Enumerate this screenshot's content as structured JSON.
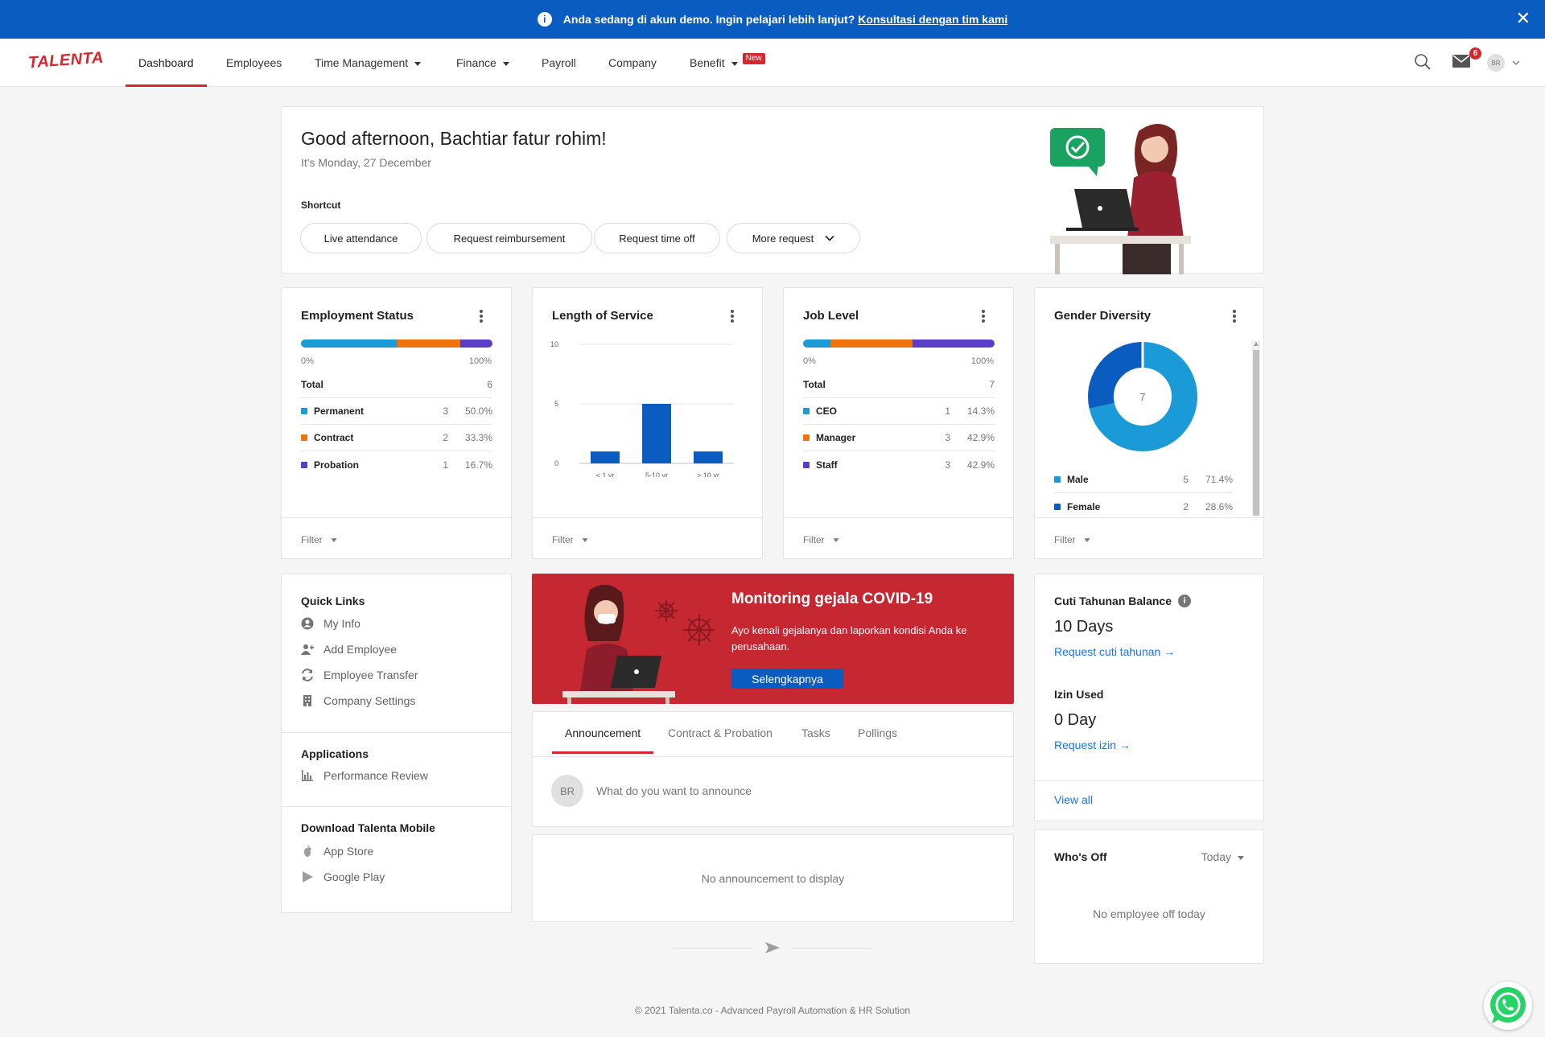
{
  "banner": {
    "text": "Anda sedang di akun demo. Ingin pelajari lebih lanjut?",
    "link": "Konsultasi dengan tim kami",
    "color": "#0b5cc0"
  },
  "nav": {
    "logo": "TALENTA",
    "items": [
      {
        "label": "Dashboard"
      },
      {
        "label": "Employees"
      },
      {
        "label": "Time Management"
      },
      {
        "label": "Finance"
      },
      {
        "label": "Payroll"
      },
      {
        "label": "Company"
      },
      {
        "label": "Benefit"
      }
    ],
    "new_badge": "New",
    "mail_count": "6",
    "avatar": "BR",
    "accent": "#d7262d"
  },
  "greeting": {
    "title": "Good afternoon, Bachtiar fatur rohim!",
    "date": "It's Monday, 27 December",
    "shortcut_label": "Shortcut",
    "shortcuts": [
      "Live attendance",
      "Request reimbursement",
      "Request time off",
      "More request"
    ]
  },
  "employment_status": {
    "title": "Employment Status",
    "min_label": "0%",
    "max_label": "100%",
    "total_label": "Total",
    "total": "6",
    "rows": [
      {
        "label": "Permanent",
        "count": "3",
        "pct": "50.0%",
        "color": "#1a9ad6"
      },
      {
        "label": "Contract",
        "count": "2",
        "pct": "33.3%",
        "color": "#f0720b"
      },
      {
        "label": "Probation",
        "count": "1",
        "pct": "16.7%",
        "color": "#5b3ec8"
      }
    ],
    "filter": "Filter"
  },
  "length_of_service": {
    "title": "Length of Service",
    "filter": "Filter"
  },
  "job_level": {
    "title": "Job Level",
    "min_label": "0%",
    "max_label": "100%",
    "total_label": "Total",
    "total": "7",
    "rows": [
      {
        "label": "CEO",
        "count": "1",
        "pct": "14.3%",
        "color": "#1a9ad6"
      },
      {
        "label": "Manager",
        "count": "3",
        "pct": "42.9%",
        "color": "#f0720b"
      },
      {
        "label": "Staff",
        "count": "3",
        "pct": "42.9%",
        "color": "#5b3ec8"
      }
    ],
    "filter": "Filter"
  },
  "gender_diversity": {
    "title": "Gender Diversity",
    "center": "7",
    "rows": [
      {
        "label": "Male",
        "count": "5",
        "pct": "71.4%",
        "color": "#1a9ad6"
      },
      {
        "label": "Female",
        "count": "2",
        "pct": "28.6%",
        "color": "#0b5cc0"
      }
    ],
    "filter": "Filter"
  },
  "chart_data": {
    "type": "bar",
    "categories": [
      "< 1 yr",
      "5-10 yr",
      "> 10 yr"
    ],
    "values": [
      1,
      5,
      1
    ],
    "yticks": [
      0,
      5,
      10
    ],
    "ylim": [
      0,
      10
    ],
    "title": "",
    "xlabel": "",
    "ylabel": "",
    "color": "#0b5cc0",
    "grid": true
  },
  "quick_links": {
    "title": "Quick Links",
    "items": [
      {
        "label": "My Info",
        "icon": "person-icon"
      },
      {
        "label": "Add Employee",
        "icon": "add-person-icon"
      },
      {
        "label": "Employee Transfer",
        "icon": "transfer-icon"
      },
      {
        "label": "Company Settings",
        "icon": "building-icon"
      }
    ],
    "apps_title": "Applications",
    "apps": [
      {
        "label": "Performance Review",
        "icon": "chart-icon"
      }
    ],
    "mobile_title": "Download Talenta Mobile",
    "mobile": [
      {
        "label": "App Store",
        "icon": "apple-icon"
      },
      {
        "label": "Google Play",
        "icon": "play-icon"
      }
    ]
  },
  "covid": {
    "title": "Monitoring gejala COVID-19",
    "text": "Ayo kenali gejalanya dan laporkan kondisi Anda ke perusahaan.",
    "button": "Selengkapnya",
    "bg": "#c62832"
  },
  "tabs": {
    "items": [
      "Announcement",
      "Contract & Probation",
      "Tasks",
      "Pollings"
    ],
    "avatar": "BR",
    "placeholder": "What do you want to announce",
    "empty": "No announcement to display"
  },
  "leave": {
    "cuti_title": "Cuti Tahunan Balance",
    "cuti_value": "10 Days",
    "cuti_link": "Request cuti tahunan →",
    "izin_title": "Izin Used",
    "izin_value": "0 Day",
    "izin_link": "Request izin →",
    "view_all": "View all"
  },
  "whos_off": {
    "title": "Who's Off",
    "period": "Today",
    "empty": "No employee off today"
  },
  "footer": {
    "text": "© 2021 Talenta.co - Advanced Payroll Automation & HR Solution"
  }
}
